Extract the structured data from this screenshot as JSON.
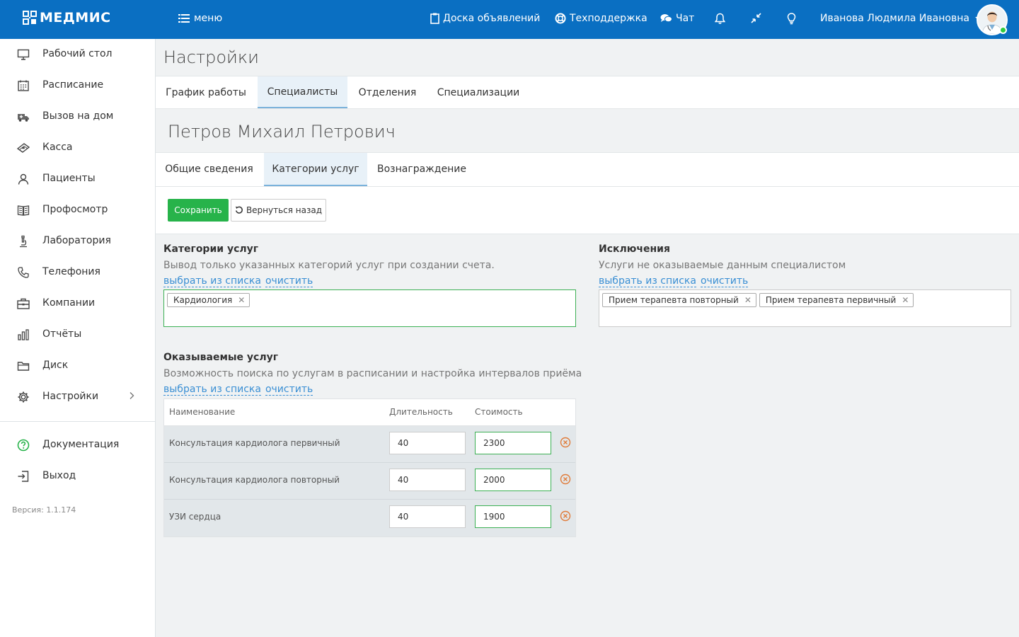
{
  "topbar": {
    "logo_text": "МЕДМИС",
    "menu_label": "меню",
    "board_label": "Доска объявлений",
    "support_label": "Техподдержка",
    "chat_label": "Чат",
    "user_name": "Иванова Людмила Ивановна",
    "bg_color": "#0a6fc2"
  },
  "sidebar": {
    "items": [
      {
        "label": "Рабочий стол",
        "icon": "monitor-icon"
      },
      {
        "label": "Расписание",
        "icon": "calendar-icon"
      },
      {
        "label": "Вызов на дом",
        "icon": "ambulance-icon"
      },
      {
        "label": "Касса",
        "icon": "money-icon"
      },
      {
        "label": "Пациенты",
        "icon": "users-icon"
      },
      {
        "label": "Профосмотр",
        "icon": "book-icon"
      },
      {
        "label": "Лаборатория",
        "icon": "microscope-icon"
      },
      {
        "label": "Телефония",
        "icon": "phone-icon"
      },
      {
        "label": "Компании",
        "icon": "briefcase-icon"
      },
      {
        "label": "Отчёты",
        "icon": "bar-chart-icon"
      },
      {
        "label": "Диск",
        "icon": "folder-icon"
      },
      {
        "label": "Настройки",
        "icon": "gear-icon"
      }
    ],
    "bottom_items": [
      {
        "label": "Документация",
        "icon": "help-icon"
      },
      {
        "label": "Выход",
        "icon": "logout-icon"
      }
    ],
    "version": "Версия: 1.1.174"
  },
  "page": {
    "title": "Настройки",
    "tabs": [
      "График работы",
      "Специалисты",
      "Отделения",
      "Специализации"
    ],
    "active_tab": "Специалисты",
    "person_name": "Петров Михаил Петрович",
    "sub_tabs": [
      "Общие сведения",
      "Категории услуг",
      "Вознаграждение"
    ],
    "active_sub_tab": "Категории услуг",
    "save_label": "Сохранить",
    "back_label": "Вернуться назад"
  },
  "categories": {
    "title": "Категории услуг",
    "description": "Вывод только указанных категорий услуг при создании счета.",
    "select_link": "выбрать из списка",
    "clear_link": "очистить",
    "tags": [
      "Кардиология"
    ]
  },
  "exclusions": {
    "title": "Исключения",
    "description": "Услуги не оказываемые данным специалистом",
    "select_link": "выбрать из списка",
    "clear_link": "очистить",
    "tags": [
      "Прием терапевта повторный",
      "Прием терапевта первичный"
    ]
  },
  "services": {
    "title": "Оказываемые услуг",
    "description": "Возможность поиска по услугам в расписании и настройка интервалов приёма",
    "select_link": "выбрать из списка",
    "clear_link": "очистить",
    "columns": [
      "Наименование",
      "Длительность",
      "Стоимость"
    ],
    "rows": [
      {
        "name": "Консультация кардиолога первичный",
        "duration": "40",
        "cost": "2300"
      },
      {
        "name": "Консультация кардиолога повторный",
        "duration": "40",
        "cost": "2000"
      },
      {
        "name": "УЗИ сердца",
        "duration": "40",
        "cost": "1900"
      }
    ]
  },
  "colors": {
    "accent": "#0a6fc2",
    "save_button": "#27b34a",
    "link": "#3a8fd4",
    "delete_icon": "#e07b39"
  }
}
